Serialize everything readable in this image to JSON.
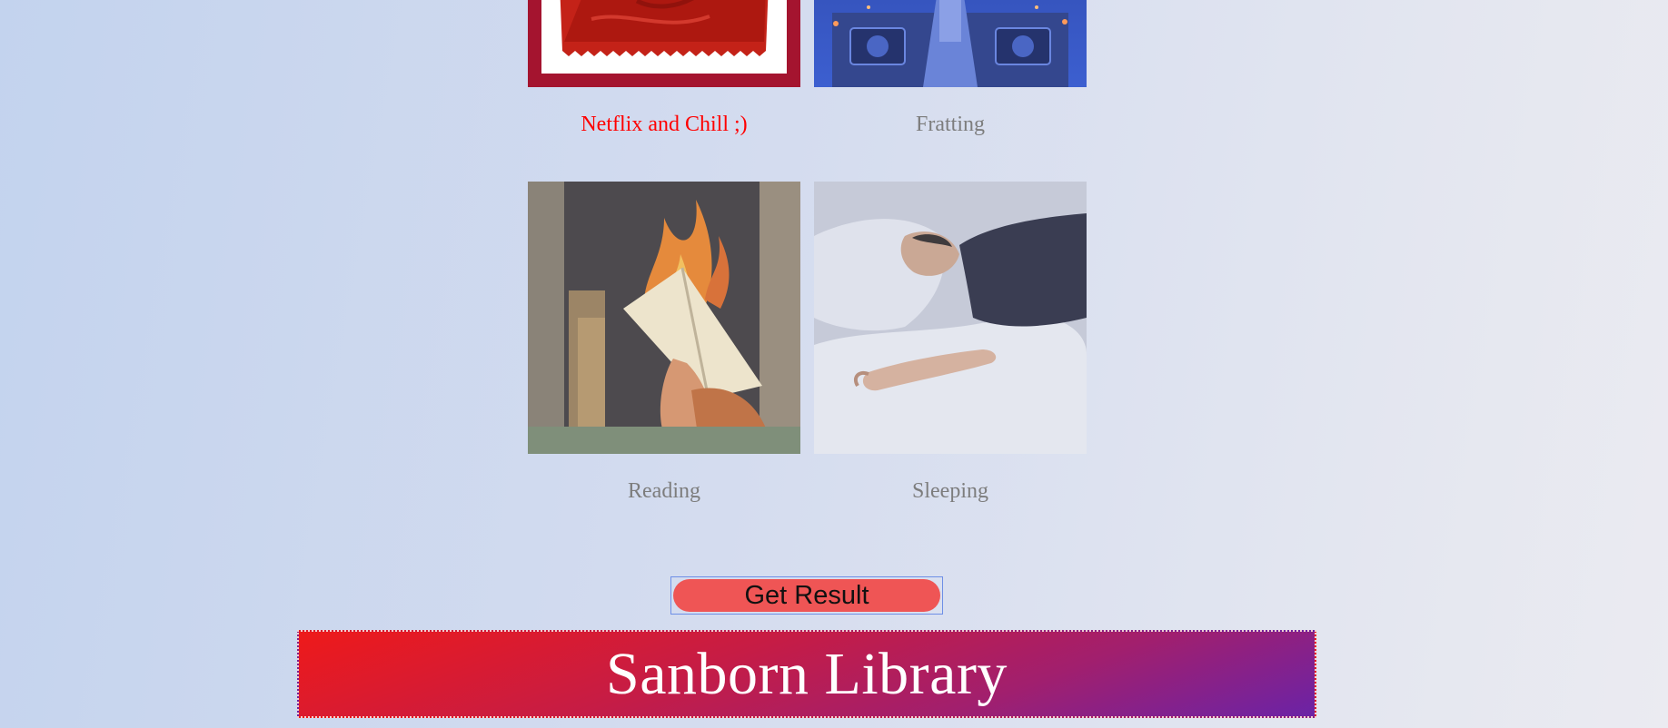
{
  "options": [
    {
      "label": "Netflix and Chill ;)",
      "selected": true
    },
    {
      "label": "Fratting",
      "selected": false
    },
    {
      "label": "Reading",
      "selected": false
    },
    {
      "label": "Sleeping",
      "selected": false
    }
  ],
  "submit": {
    "label": "Get Result"
  },
  "footer": {
    "title": "Sanborn Library"
  },
  "colors": {
    "selected_caption": "#ff0000",
    "caption": "#7d7d7d",
    "button": "#ef5555",
    "selected_border": "#a4142f"
  }
}
